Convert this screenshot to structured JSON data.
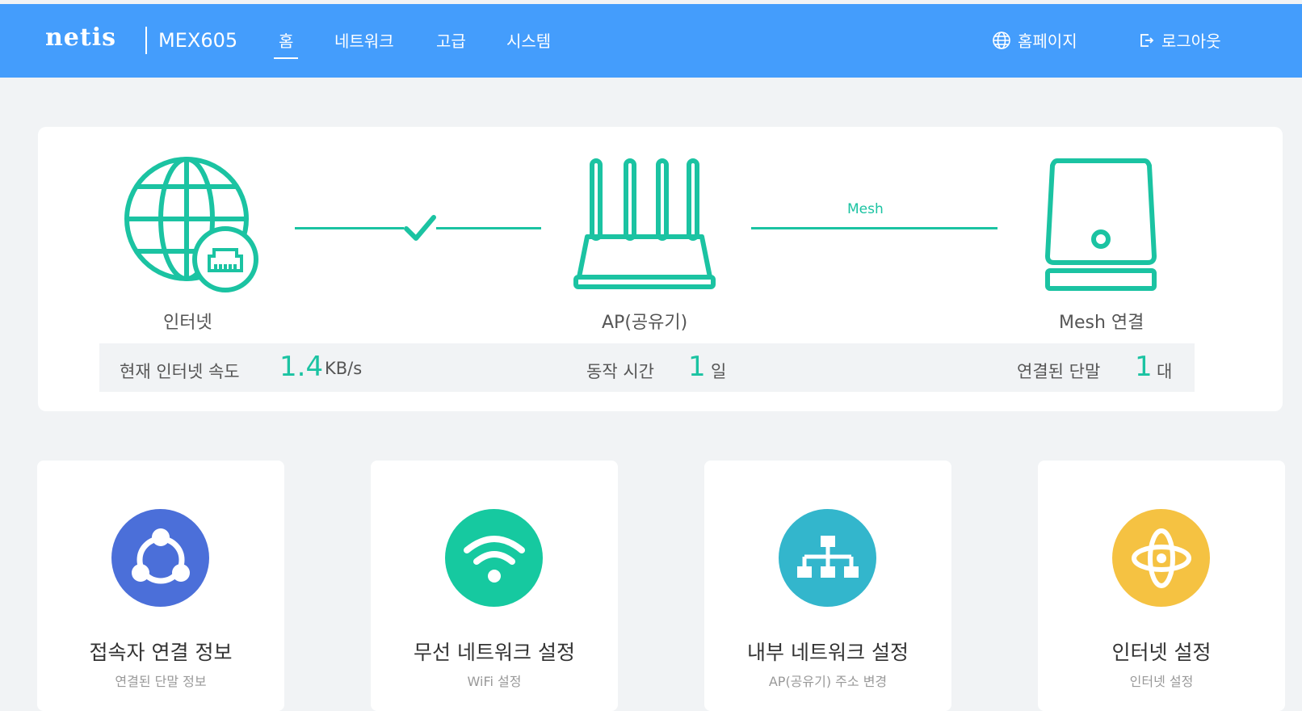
{
  "header": {
    "brand": "netis",
    "model": "MEX605",
    "nav": [
      "홈",
      "네트워크",
      "고급",
      "시스템"
    ],
    "homepage_label": "홈페이지",
    "logout_label": "로그아웃"
  },
  "topology": {
    "internet_label": "인터넷",
    "ap_label": "AP(공유기)",
    "mesh_label": "Mesh 연결",
    "mesh_link_text": "Mesh",
    "internet_link_status": "connected"
  },
  "stats": {
    "speed_label": "현재 인터넷 속도",
    "speed_value": "1.4",
    "speed_unit": "KB/s",
    "uptime_label": "동작 시간",
    "uptime_value": "1",
    "uptime_unit": "일",
    "clients_label": "연결된 단말",
    "clients_value": "1",
    "clients_unit": "대"
  },
  "tiles": [
    {
      "title": "접속자 연결 정보",
      "subtitle": "연결된 단말 정보",
      "icon": "share-icon",
      "color": "#4b6fd9"
    },
    {
      "title": "무선 네트워크 설정",
      "subtitle": "WiFi 설정",
      "icon": "wifi-icon",
      "color": "#16c9a0"
    },
    {
      "title": "내부 네트워크 설정",
      "subtitle": "AP(공유기) 주소 변경",
      "icon": "network-tree-icon",
      "color": "#33b6cc"
    },
    {
      "title": "인터넷 설정",
      "subtitle": "인터넷 설정",
      "icon": "atom-icon",
      "color": "#f5c242"
    }
  ],
  "colors": {
    "header_bg": "#449dfc",
    "accent": "#1bc3a2",
    "page_bg": "#f1f3f5"
  }
}
